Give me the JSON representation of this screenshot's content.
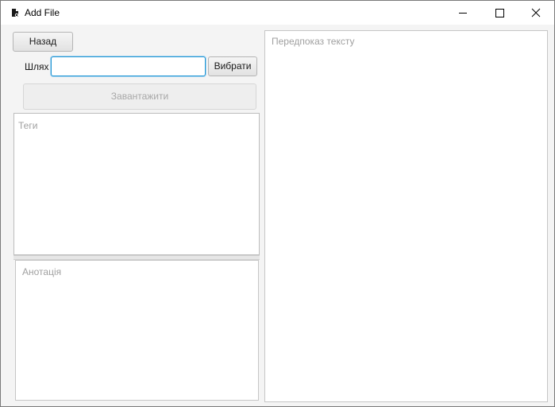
{
  "window": {
    "title": "Add File"
  },
  "toolbar": {
    "back_label": "Назад",
    "path_label": "Шлях",
    "path_value": "",
    "choose_label": "Вибрати",
    "upload_label": "Завантажити"
  },
  "fields": {
    "tags_placeholder": "Теги",
    "annotation_placeholder": "Анотація",
    "preview_placeholder": "Передпоказ тексту"
  },
  "icons": {
    "app": "file-app-icon",
    "minimize": "minimize-icon",
    "maximize": "maximize-icon",
    "close": "close-icon"
  },
  "colors": {
    "focus_border": "#2196d3",
    "placeholder": "#a0a0a0"
  }
}
